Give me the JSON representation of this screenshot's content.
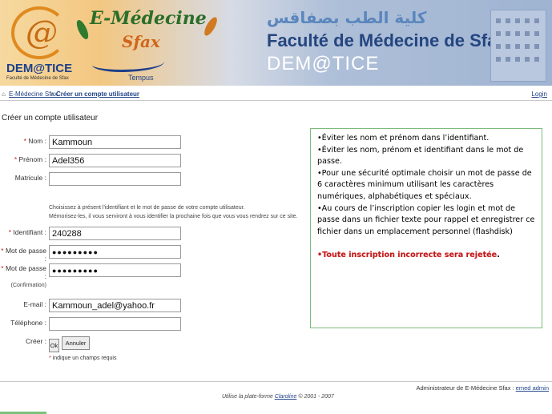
{
  "banner": {
    "logo_text": "DEM@TICE",
    "logo_subtitle": "Faculté de Médecine de Sfax",
    "emed_title": "E-Médecine",
    "emed_city": "Sfax",
    "tempus": "Tempus",
    "arabic_name": "كلية الطب بصفاقس",
    "faculty_name": "Faculté de Médecine de Sfax",
    "dematice": "DEM@TICE"
  },
  "breadcrumb": {
    "home": "E-Médecine Sfax",
    "separator": ">",
    "current": "Créer un compte utilisateur",
    "login": "Login"
  },
  "page_title": "Créer un compte utilisateur",
  "form": {
    "nom": {
      "label": "Nom :",
      "value": "Kammoun"
    },
    "prenom": {
      "label": "Prénom :",
      "value": "Adel356"
    },
    "matricule": {
      "label": "Matricule :",
      "value": ""
    },
    "help_line1": "Choisissez à présent l'identifiant et le mot de passe de votre compte utilisateur.",
    "help_line2": "Mémorisez-les, il vous serviront à vous identifier la prochaine fois que vous vous rendrez sur ce site.",
    "identifiant": {
      "label": "Identifiant :",
      "value": "240288"
    },
    "password": {
      "label": "Mot de passe :",
      "value": "●●●●●●●●●"
    },
    "password_confirm": {
      "label": "Mot de passe :",
      "sublabel": "(Confirmation)",
      "value": "●●●●●●●●●"
    },
    "email": {
      "label": "E-mail :",
      "value": "Kammoun_adel@yahoo.fr"
    },
    "telephone": {
      "label": "Téléphone :",
      "value": ""
    },
    "create_label": "Créer :",
    "ok_label": "Ok",
    "cancel_label": "Annuler",
    "required_mark": "*",
    "required_note": "indique un champs requis"
  },
  "info": {
    "items": [
      "•Éviter les nom et prénom dans l’identifiant.",
      "•Éviter les nom, prénom et identifiant dans le mot de passe.",
      "•Pour une sécurité optimale choisir un mot de passe de 6 caractères minimum utilisant les caractères numériques, alphabétiques et spéciaux.",
      "•Au cours de l’inscription copier les login et mot de passe dans un fichier texte pour rappel et enregistrer ce fichier dans un emplacement personnel (flashdisk)"
    ],
    "warning": "•Toute inscription incorrecte sera rejetée",
    "warning_end": "."
  },
  "footer": {
    "admin_text": "Administrateur de E-Médecine Sfax :",
    "admin_link": "emed admin",
    "copyright_prefix": "Utilise la plate-forme",
    "copyright_link": "Claroline",
    "copyright_suffix": "© 2001 - 2007"
  },
  "colors": {
    "link": "#224488",
    "required": "#c62020",
    "box_border": "#7dbb7d",
    "warning": "#c21a1a"
  }
}
